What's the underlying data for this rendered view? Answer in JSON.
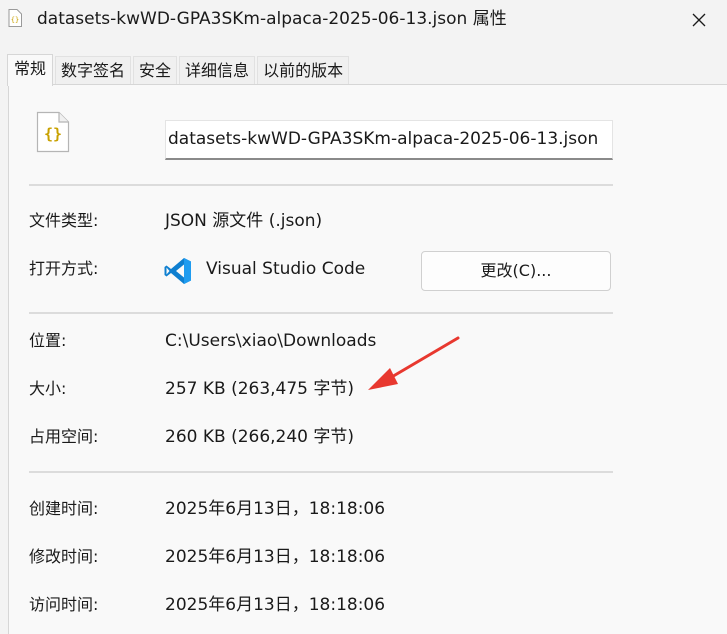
{
  "window": {
    "title": "datasets-kwWD-GPA3SKm-alpaca-2025-06-13.json 属性",
    "close_glyph": "✕"
  },
  "tabs": [
    {
      "label": "常规",
      "active": true
    },
    {
      "label": "数字签名",
      "active": false
    },
    {
      "label": "安全",
      "active": false
    },
    {
      "label": "详细信息",
      "active": false
    },
    {
      "label": "以前的版本",
      "active": false
    }
  ],
  "file": {
    "icon_glyph": "{}",
    "name": "datasets-kwWD-GPA3SKm-alpaca-2025-06-13.json"
  },
  "general": {
    "type_label": "文件类型:",
    "type_value": "JSON 源文件 (.json)",
    "open_with_label": "打开方式:",
    "open_with_app": "Visual Studio Code",
    "change_button": "更改(C)...",
    "location_label": "位置:",
    "location_value": "C:\\Users\\xiao\\Downloads",
    "size_label": "大小:",
    "size_value": "257 KB (263,475 字节)",
    "disk_size_label": "占用空间:",
    "disk_size_value": "260 KB (266,240 字节)",
    "created_label": "创建时间:",
    "created_value": "2025年6月13日，18:18:06",
    "modified_label": "修改时间:",
    "modified_value": "2025年6月13日，18:18:06",
    "accessed_label": "访问时间:",
    "accessed_value": "2025年6月13日，18:18:06"
  },
  "colors": {
    "accent_vscode": "#0078d4",
    "annotation_arrow": "#e8382f",
    "json_icon": "#c8a100"
  }
}
